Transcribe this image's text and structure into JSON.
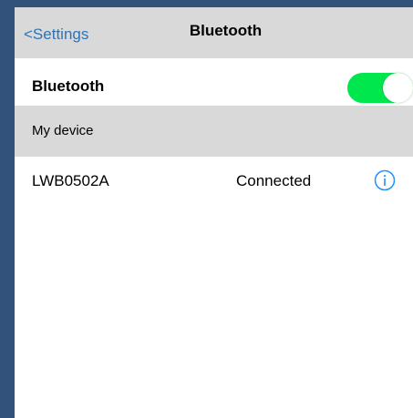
{
  "navbar": {
    "back_label": "<Settings",
    "title": "Bluetooth"
  },
  "bluetooth_row": {
    "label": "Bluetooth",
    "toggle_on": true,
    "toggle_color": "#00e64d"
  },
  "section": {
    "label": "My device"
  },
  "devices": [
    {
      "name": "LWB0502A",
      "status": "Connected",
      "icon": "info-icon"
    }
  ],
  "colors": {
    "link": "#2e74b5",
    "frame": "#32527b",
    "header_bg": "#d9d9d9"
  }
}
